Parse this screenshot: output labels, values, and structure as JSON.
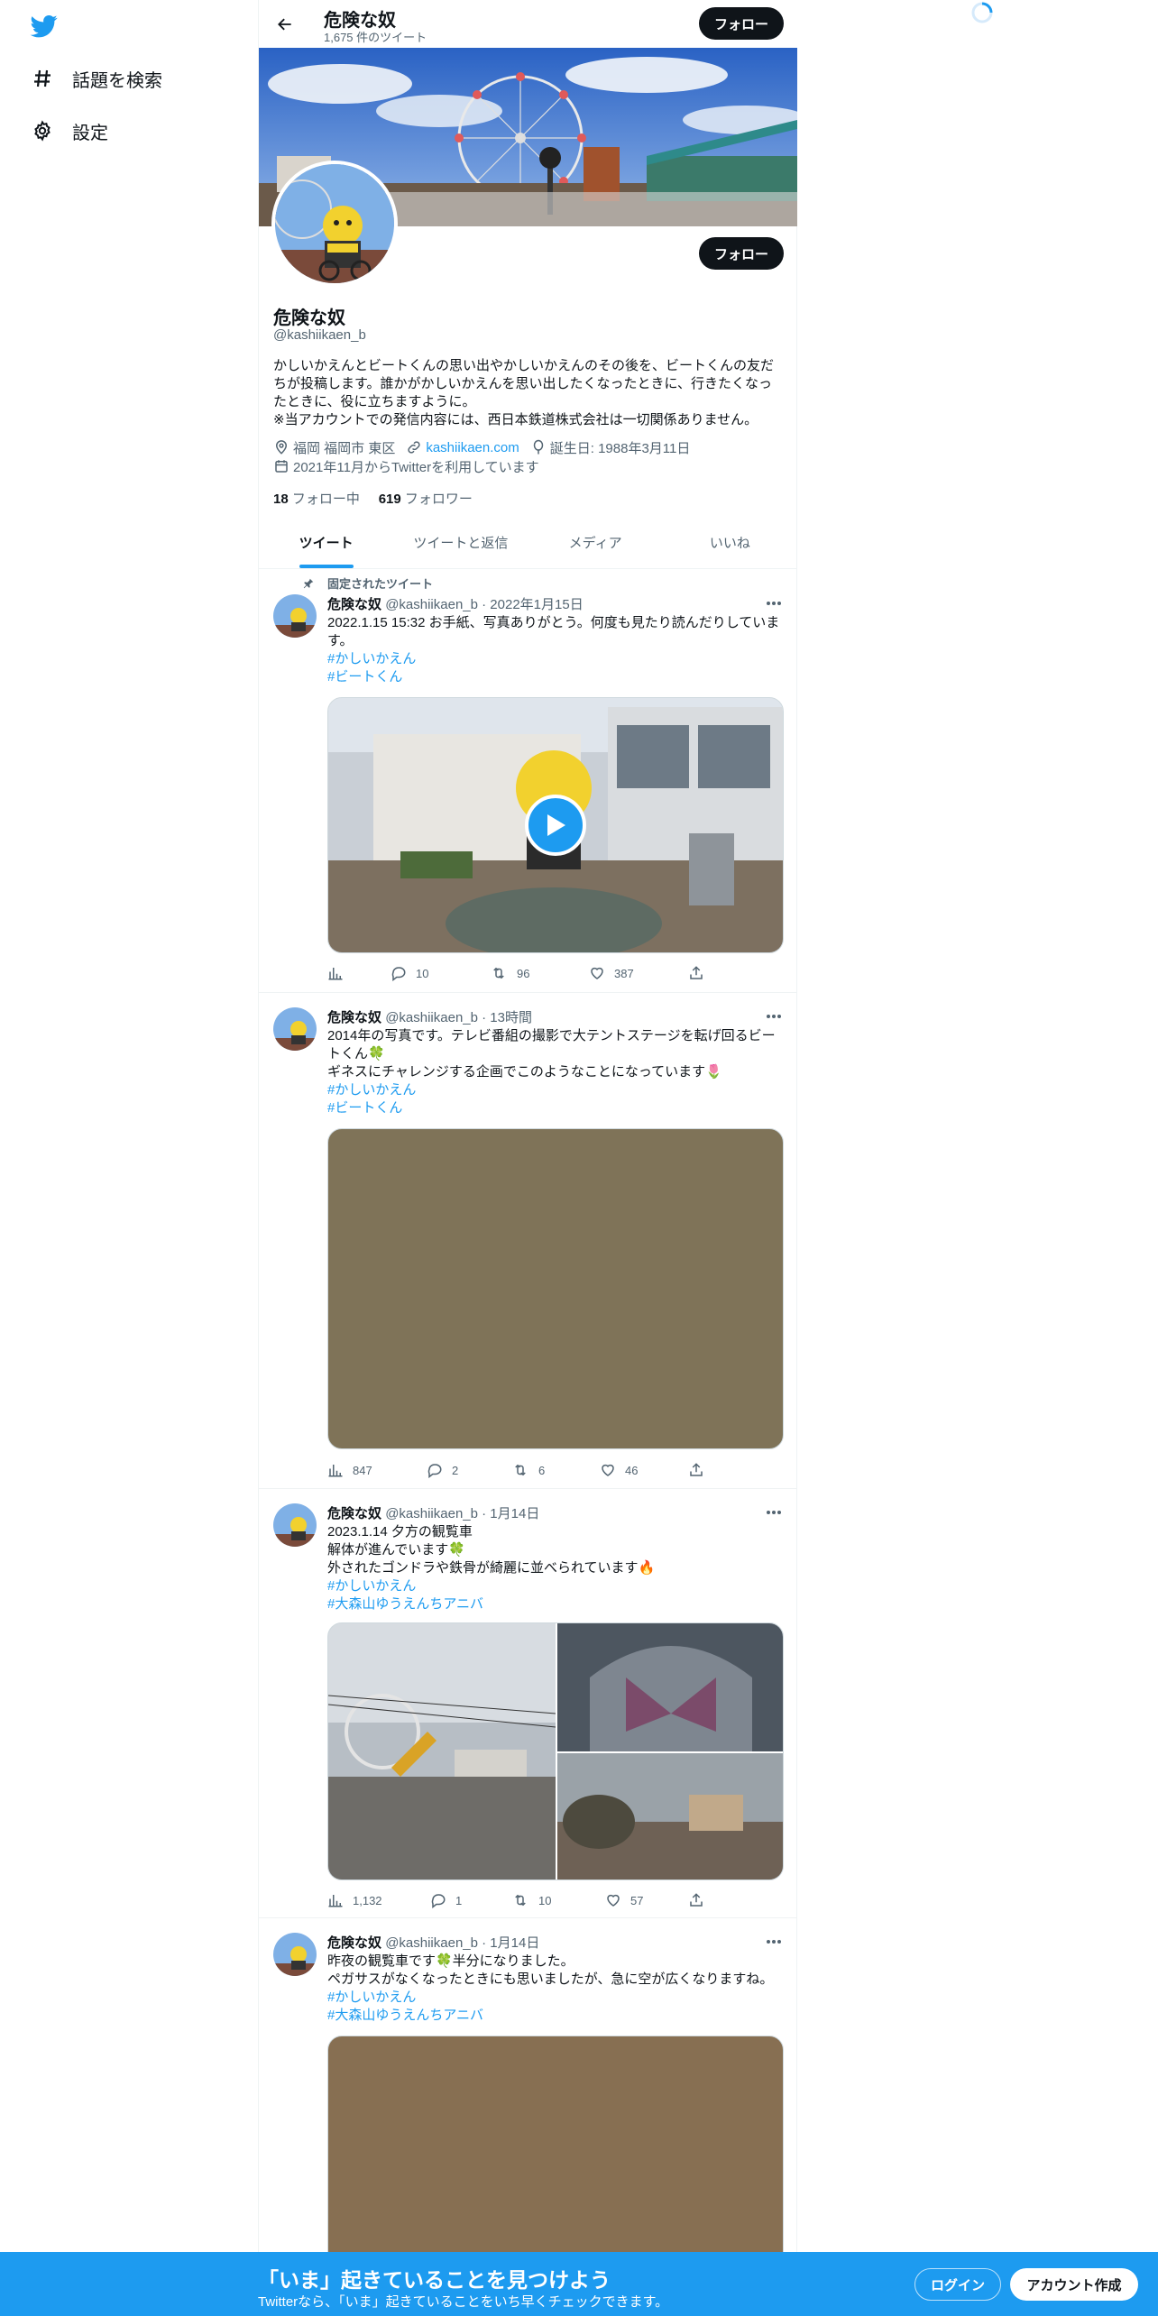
{
  "colors": {
    "accent": "#1d9bf0",
    "text": "#0f1419",
    "muted": "#536471",
    "button": "#0f1419"
  },
  "nav": {
    "items": [
      {
        "label": "話題を検索",
        "icon": "hashtag-icon"
      },
      {
        "label": "設定",
        "icon": "gear-icon"
      }
    ]
  },
  "header": {
    "name": "危険な奴",
    "tweet_count": "1,675 件のツイート",
    "follow_label": "フォロー"
  },
  "profile": {
    "name": "危険な奴",
    "handle": "@kashiikaen_b",
    "follow_label": "フォロー",
    "bio_lines": [
      "かしいかえんとビートくんの思い出やかしいかえんのその後を、ビートくんの友だ",
      "ちが投稿します。誰かがかしいかえんを思い出したくなったときに、行きたくなっ",
      "たときに、役に立ちますように。",
      "※当アカウントでの発信内容には、西日本鉄道株式会社は一切関係ありません。"
    ],
    "location": "福岡 福岡市 東区",
    "website": "kashiikaen.com",
    "birthday": "誕生日: 1988年3月11日",
    "joined": "2021年11月からTwitterを利用しています",
    "following_count": "18",
    "following_label": " フォロー中",
    "followers_count": "619",
    "followers_label": " フォロワー"
  },
  "tabs": [
    {
      "label": "ツイート",
      "active": true
    },
    {
      "label": "ツイートと返信",
      "active": false
    },
    {
      "label": "メディア",
      "active": false
    },
    {
      "label": "いいね",
      "active": false
    }
  ],
  "pinned_label": "固定されたツイート",
  "tweets": [
    {
      "name": "危険な奴",
      "handle_time": "@kashiikaen_b · 2022年1月15日",
      "lines": [
        "2022.1.15 15:32 お手紙、写真ありがとう。何度も見たり読んだりしていま",
        "す。"
      ],
      "tags": [
        "#かしいかえん",
        "#ビートくん"
      ],
      "views": "",
      "replies": "10",
      "retweets": "96",
      "likes": "387"
    },
    {
      "name": "危険な奴",
      "handle_time": "@kashiikaen_b · 13時間",
      "lines": [
        "2014年の写真です。テレビ番組の撮影で大テントステージを転げ回るビー",
        "トくん🍀",
        "ギネスにチャレンジする企画でこのようなことになっています🌷"
      ],
      "tags": [
        "#かしいかえん",
        "#ビートくん"
      ],
      "views": "847",
      "replies": "2",
      "retweets": "6",
      "likes": "46"
    },
    {
      "name": "危険な奴",
      "handle_time": "@kashiikaen_b · 1月14日",
      "lines": [
        "2023.1.14 夕方の観覧車",
        "解体が進んでいます🍀",
        "外されたゴンドラや鉄骨が綺麗に並べられています🔥"
      ],
      "tags": [
        "#かしいかえん",
        "#大森山ゆうえんちアニバ"
      ],
      "views": "1,132",
      "replies": "1",
      "retweets": "10",
      "likes": "57"
    },
    {
      "name": "危険な奴",
      "handle_time": "@kashiikaen_b · 1月14日",
      "lines": [
        "昨夜の観覧車です🍀半分になりました。",
        "ペガサスがなくなったときにも思いましたが、急に空が広くなりますね。"
      ],
      "tags": [
        "#かしいかえん",
        "#大森山ゆうえんちアニバ"
      ],
      "views": "",
      "replies": "",
      "retweets": "",
      "likes": ""
    }
  ],
  "bottom": {
    "title": "「いま」起きていることを見つけよう",
    "subtitle": "Twitterなら、「いま」起きていることをいち早くチェックできます。",
    "login": "ログイン",
    "signup": "アカウント作成"
  }
}
